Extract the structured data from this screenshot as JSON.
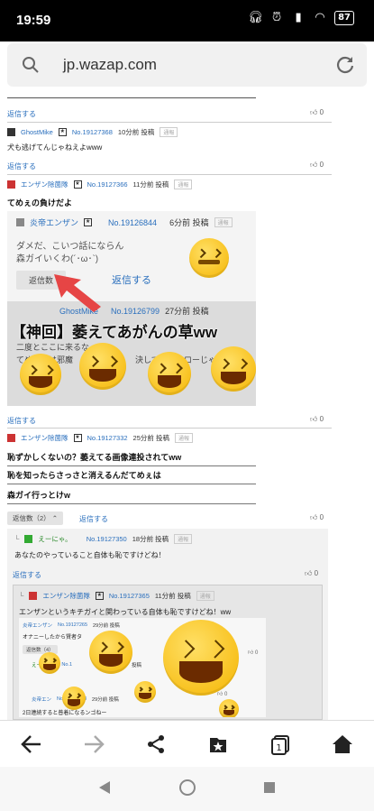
{
  "status": {
    "time": "19:59",
    "battery": "87"
  },
  "browser": {
    "url": "jp.wazap.com"
  },
  "colors": {
    "link": "#2a6fbd",
    "accent": "#f5b400"
  },
  "top": {
    "reply_label": "返信する",
    "thumb_count": "0"
  },
  "comments": [
    {
      "name": "GhostMike",
      "num": "No.19127368",
      "time": "10分前 投稿",
      "report": "通報",
      "text": "犬も逃げてんじゃねえよwww",
      "reply_label": "返信する",
      "thumb_count": "0"
    },
    {
      "name": "エンザン除菌隊",
      "num": "No.19127366",
      "time": "11分前 投稿",
      "report": "通報",
      "text": "てめぇの負けだよ",
      "reply_label": "返信する",
      "thumb_count": "0"
    },
    {
      "name": "エンザン除菌隊",
      "num": "No.19127332",
      "time": "25分前 投稿",
      "report": "通報",
      "lines": [
        "恥ずかしくないの？萎えてる画像連投されてww",
        "恥を知ったらさっさと消えるんだてめぇは",
        "森ガイ行っとけw"
      ],
      "replies_toggle": "返信数（2）",
      "reply_label": "返信する",
      "thumb_count": "0"
    }
  ],
  "embed": {
    "name": "炎帝エンザン",
    "num": "No.19126844",
    "time": "6分前 投稿",
    "report": "通報",
    "line1": "ダメだ、こいつ話にならん",
    "line2": "森ガイいくわ(´･ω･`)",
    "replies_btn": "返信数",
    "reply_link": "返信する",
    "name2": "GhostMike",
    "num2": "No.19126799",
    "time2": "27分前 投稿",
    "caption": "【神回】萎えてあがんの草ww",
    "partial1": "二度とここに来るな",
    "partial2": "てめぇらは邪魔",
    "partial3": "決して",
    "partial4": "ローじゃな"
  },
  "nested": {
    "name": "えーにゃ。",
    "num": "No.19127350",
    "time": "18分前 投稿",
    "report": "通報",
    "text": "あなたのやっていること自体も恥ですけどね！",
    "reply_label": "返信する",
    "thumb_count": "0",
    "inner": {
      "name": "エンザン除菌隊",
      "num": "No.19127365",
      "time": "11分前 投稿",
      "report": "通報",
      "text": "エンザンというキチガイと関わっている自体も恥ですけどね！ww",
      "mini": {
        "name": "炎帝エンザン",
        "num": "No.19127265",
        "time": "29分前 投稿",
        "text": "オナニーしたから賢者タ",
        "replies": "返信数（4）",
        "sub_name": "えーにゃ。",
        "sub_num": "No.1",
        "sub_time": "投稿",
        "name3": "炎帝エン",
        "num3": "No.19127273",
        "time3": "29分前 投稿",
        "text3": "2日連続すると普着になるンゴねー",
        "thumb": "0"
      }
    }
  }
}
